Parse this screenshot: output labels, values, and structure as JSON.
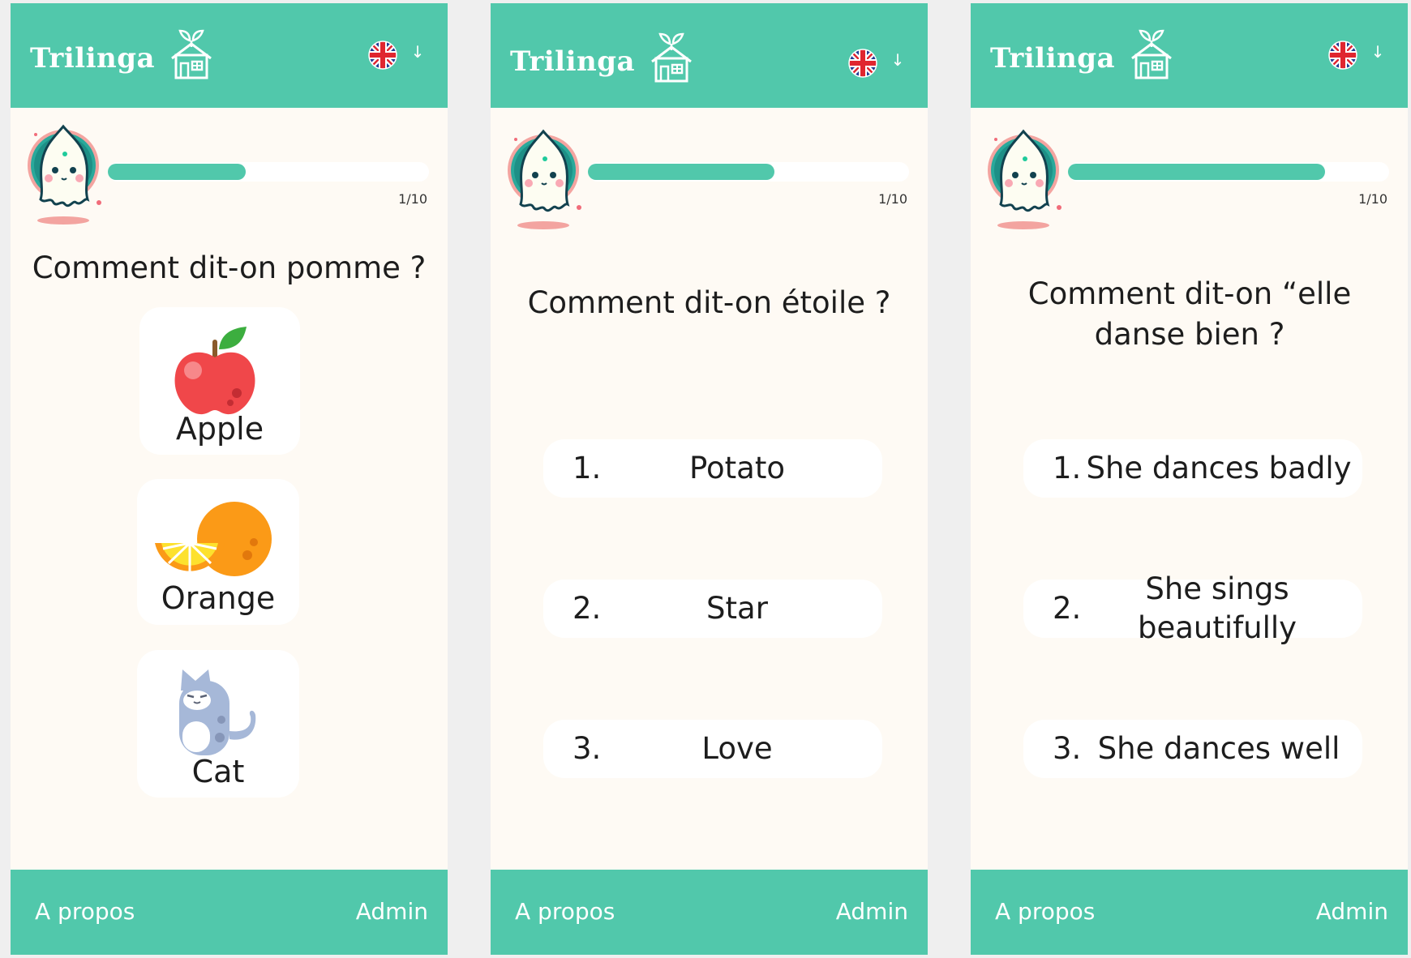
{
  "app": {
    "brand": "Trilinga",
    "accent_color": "#51c8ab",
    "background_color": "#fefaf4"
  },
  "screens": [
    {
      "header": {
        "brand": "Trilinga",
        "language_flag": "uk-flag-icon",
        "dropdown_arrow": "↓"
      },
      "progress": {
        "fraction": 0.43,
        "label": "1/10"
      },
      "question": "Comment dit-on pomme ?",
      "choices": [
        {
          "label": "Apple",
          "icon": "apple-icon"
        },
        {
          "label": "Orange",
          "icon": "orange-icon"
        },
        {
          "label": "Cat",
          "icon": "cat-icon"
        }
      ],
      "footer": {
        "about": "A propos",
        "admin": "Admin"
      }
    },
    {
      "header": {
        "brand": "Trilinga",
        "language_flag": "uk-flag-icon",
        "dropdown_arrow": "↓"
      },
      "progress": {
        "fraction": 0.58,
        "label": "1/10"
      },
      "question": "Comment dit-on étoile ?",
      "options": [
        {
          "number": "1.",
          "text": "Potato"
        },
        {
          "number": "2.",
          "text": "Star"
        },
        {
          "number": "3.",
          "text": "Love"
        }
      ],
      "footer": {
        "about": "A propos",
        "admin": "Admin"
      }
    },
    {
      "header": {
        "brand": "Trilinga",
        "language_flag": "uk-flag-icon",
        "dropdown_arrow": "↓"
      },
      "progress": {
        "fraction": 0.8,
        "label": "1/10"
      },
      "question": "Comment dit-on “elle danse bien ?",
      "options": [
        {
          "number": "1.",
          "text": "She dances badly"
        },
        {
          "number": "2.",
          "text": "She sings beautifully"
        },
        {
          "number": "3.",
          "text": "She dances well"
        }
      ],
      "footer": {
        "about": "A propos",
        "admin": "Admin"
      }
    }
  ]
}
